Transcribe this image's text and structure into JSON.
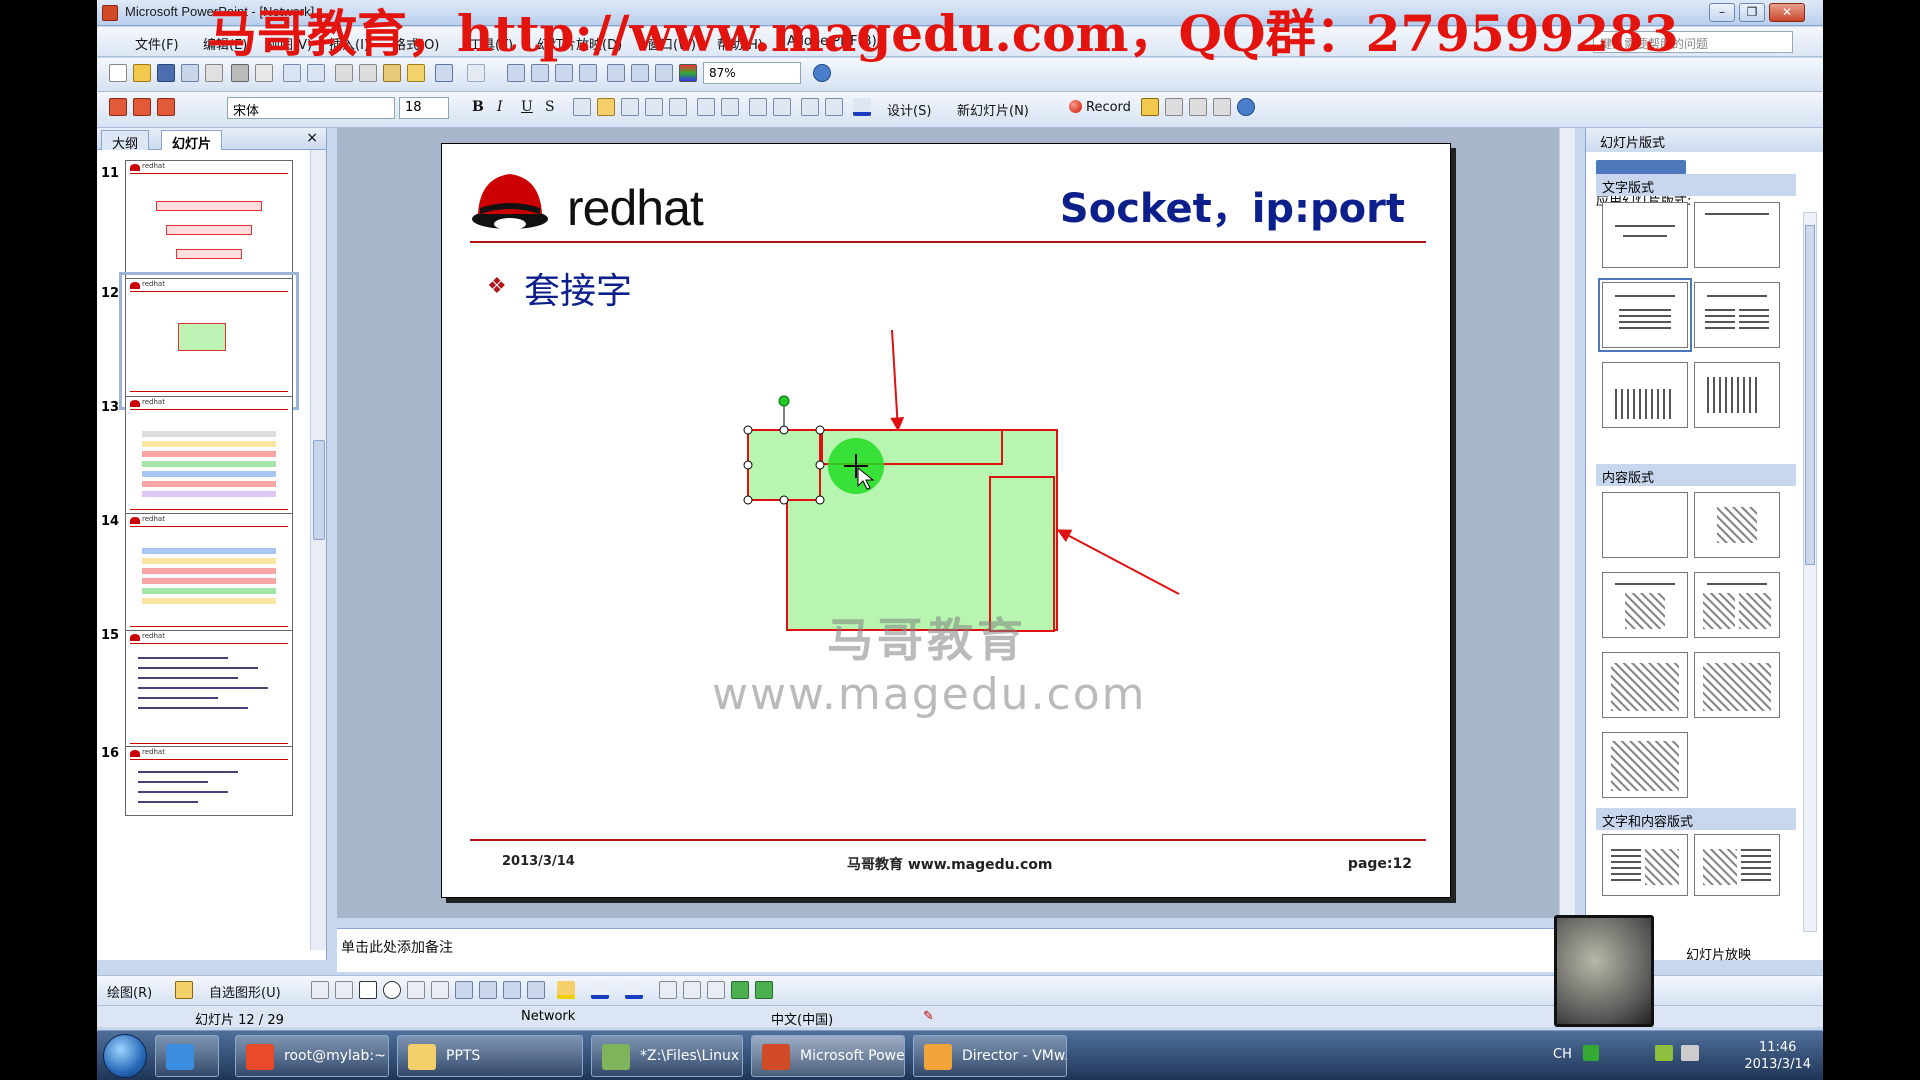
{
  "window": {
    "title": "Microsoft PowerPoint - [Network]",
    "banner": "马哥教育，http://www.magedu.com，QQ群：279599283"
  },
  "menu": [
    "文件(F)",
    "编辑(E)",
    "视图(V)",
    "插入(I)",
    "格式(O)",
    "工具(T)",
    "幻灯片放映(D)",
    "窗口(W)",
    "帮助(H)",
    "Adobe PDF(B)"
  ],
  "help_placeholder": "键入需要帮助的问题",
  "toolbar1": {
    "zoom": "87%"
  },
  "toolbar2": {
    "font": "宋体",
    "size": "18",
    "bold": "B",
    "italic": "I",
    "underline": "U",
    "shadow": "S",
    "design": "设计(S)",
    "new_slide": "新幻灯片(N)",
    "record": "Record"
  },
  "left_pane": {
    "tab_outline": "大纲",
    "tab_slides": "幻灯片",
    "close": "×",
    "thumbnails": [
      {
        "num": "11",
        "label": "redhat"
      },
      {
        "num": "12",
        "label": "redhat"
      },
      {
        "num": "13",
        "label": "redhat"
      },
      {
        "num": "14",
        "label": "redhat"
      },
      {
        "num": "15",
        "label": "redhat"
      },
      {
        "num": "16",
        "label": "redhat"
      }
    ]
  },
  "slide": {
    "logo": "redhat",
    "title": "Socket，ip:port",
    "bullet": "套接字",
    "watermark_cn": "马哥教育",
    "watermark_url": "www.magedu.com",
    "date": "2013/3/14",
    "footer": "马哥教育 www.magedu.com",
    "page_label": "page:",
    "page_num": "12"
  },
  "notes_placeholder": "单击此处添加备注",
  "task_pane": {
    "title": "幻灯片版式",
    "apply": "应用幻灯片版式:",
    "section_text": "文字版式",
    "section_content": "内容版式",
    "section_text_content": "文字和内容版式",
    "show": "幻灯片放映"
  },
  "drawbar": {
    "draw": "绘图(R)",
    "autoshapes": "自选图形(U)"
  },
  "status": {
    "slide": "幻灯片 12 / 29",
    "design": "Network",
    "lang": "中文(中国)"
  },
  "taskbar": {
    "tasks": [
      "root@mylab:~ -...",
      "PPTS",
      "*Z:\\Files\\Linux A...",
      "Microsoft Powe...",
      "Director - VMw..."
    ],
    "lang": "CH",
    "time": "11:46",
    "date": "2013/3/14"
  },
  "colors": {
    "accent_red": "#b0161b",
    "title_blue": "#0c1f8b",
    "shape_fill": "#b7f5b0",
    "banner_red": "#e3130e"
  }
}
